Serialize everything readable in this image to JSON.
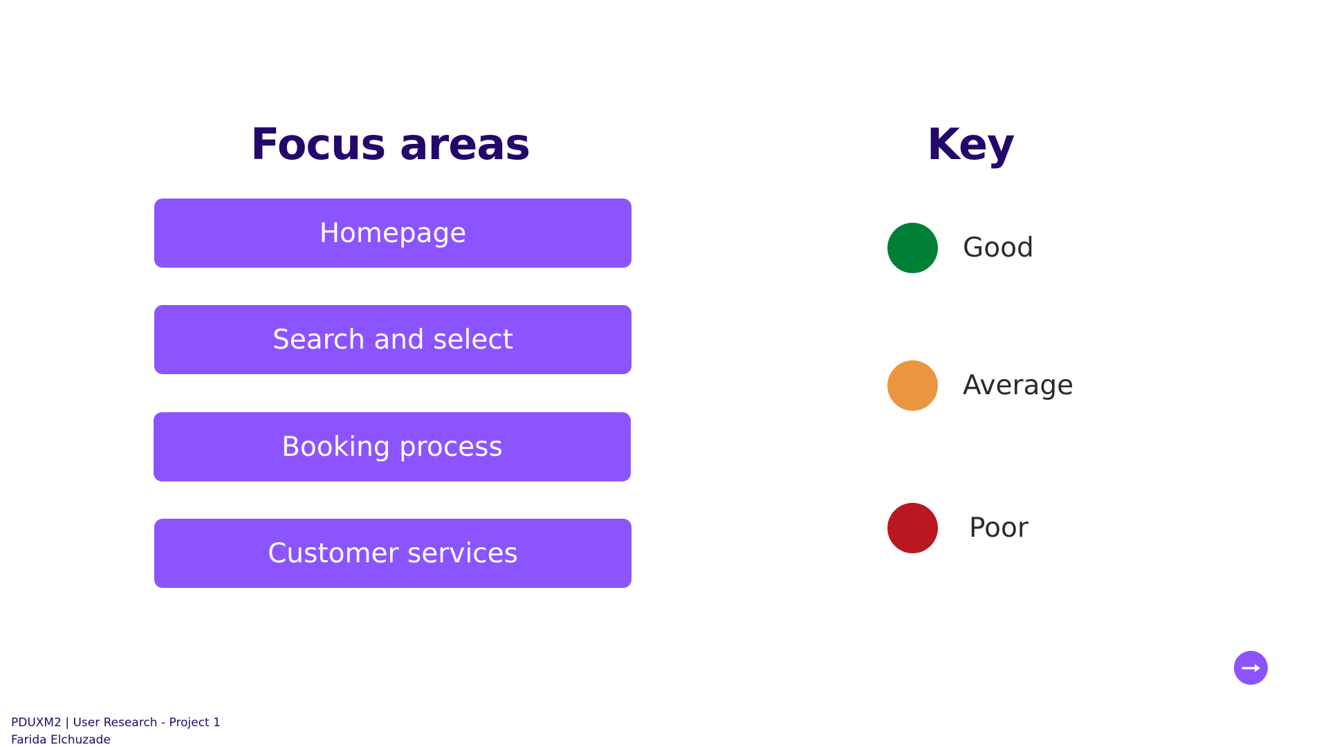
{
  "focus_areas": {
    "title": "Focus areas",
    "items": [
      {
        "label": "Homepage"
      },
      {
        "label": "Search and select"
      },
      {
        "label": "Booking process"
      },
      {
        "label": "Customer services"
      }
    ],
    "button_color": "#8c54ff"
  },
  "key": {
    "title": "Key",
    "items": [
      {
        "label": "Good",
        "color": "#008037"
      },
      {
        "label": "Average",
        "color": "#ea963f"
      },
      {
        "label": "Poor",
        "color": "#ba1821"
      }
    ]
  },
  "navigation": {
    "next_icon": "arrow-right-icon"
  },
  "footer": {
    "course": "PDUXM2 | User Research - Project 1",
    "author": "Farida Elchuzade"
  },
  "colors": {
    "heading": "#23076b",
    "accent": "#8c54ff"
  }
}
